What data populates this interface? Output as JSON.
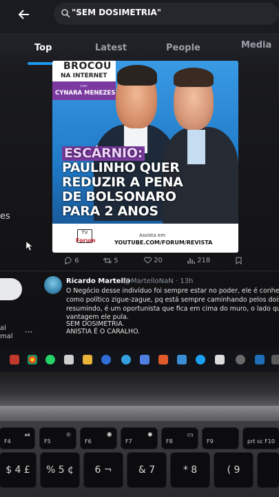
{
  "search": {
    "query": "\"SEM DOSIMETRIA\""
  },
  "tabs": [
    {
      "label": "Top"
    },
    {
      "label": "Latest"
    },
    {
      "label": "People"
    },
    {
      "label": "Media"
    }
  ],
  "left_panel": {
    "fragment": "es",
    "small1": "al",
    "small2": "mal"
  },
  "post_image": {
    "logo_brand": "BROCOU",
    "logo_sub": "NA INTERNET",
    "logo_com": "com",
    "logo_name": "CYNARA MENEZES",
    "headline": [
      "ESCÁRNIO:",
      "PAULINHO QUER",
      "REDUZIR A PENA",
      "DE BOLSONARO",
      "PARA 2 ANOS"
    ],
    "tv_logo": "TV",
    "tv_brand": "Forum",
    "cta": "Assista em",
    "url": "YOUTUBE.COM/FORUM/REVISTA"
  },
  "actions": {
    "replies": "6",
    "reposts": "5",
    "likes": "20",
    "views": "218"
  },
  "tweet": {
    "name": "Ricardo Martello",
    "handle": "@MartelloNaN · 13h",
    "lines": [
      "O Negócio desse indivíduo foi sempre estar no poder, ele é conhec",
      "como político zigue-zague,  pq está sempre caminhando pelos dois",
      "resumindo, é um oportunista que fica em cima do muro, o lado que",
      "vantagem ele pula.",
      "SEM DOSIMETRIA.",
      "ANISTIA É O CARALHO."
    ]
  },
  "keyboard": {
    "row1": [
      "F4",
      "F5",
      "F6",
      "F7",
      "F8",
      "F9",
      "prt sc F10"
    ],
    "row2": [
      "$ 4 £",
      "% 5 ¢",
      "6 ¬",
      "& 7",
      "* 8",
      "( 9"
    ]
  },
  "colors": {
    "accent": "#1d9bf0",
    "purple": "#7b3aa0"
  }
}
